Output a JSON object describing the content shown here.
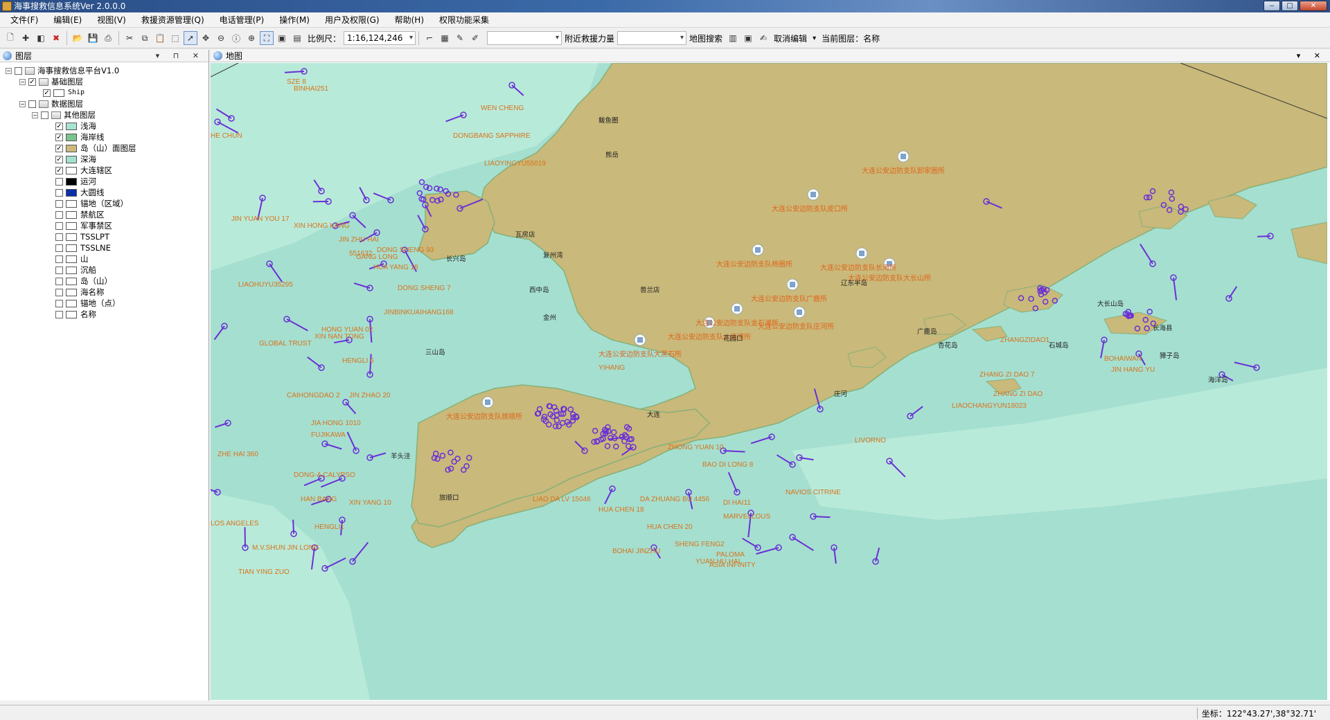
{
  "window": {
    "title": "海事搜救信息系统Ver 2.0.0.0",
    "min": "‒",
    "max": "□",
    "close": "✕"
  },
  "menubar": [
    "文件(F)",
    "编辑(E)",
    "视图(V)",
    "救援资源管理(Q)",
    "电话管理(P)",
    "操作(M)",
    "用户及权限(G)",
    "帮助(H)",
    "权限功能采集"
  ],
  "toolbar": {
    "scale_label": "比例尺：",
    "scale_value": "1:16,124,246",
    "nearby_label": "附近救援力量",
    "nearby_value": "",
    "map_search_label": "地图搜索",
    "cancel_edit_label": "取消编辑",
    "current_layer_label": "当前图层：名称"
  },
  "layer_panel": {
    "title": "图层",
    "controls": "▾ ⊓ ✕",
    "tree": {
      "root": "海事搜救信息平台V1.0",
      "base": "基础图层",
      "ship": "Ship",
      "data": "数据图层",
      "other": "其他图层",
      "layers": [
        {
          "label": "浅海",
          "checked": "✓",
          "color": "#a8e4d4"
        },
        {
          "label": "海岸线",
          "checked": "✓",
          "color": "#7cc48e"
        },
        {
          "label": "岛（山）面图层",
          "checked": "✓",
          "color": "#cdb97c"
        },
        {
          "label": "深海",
          "checked": "✓",
          "color": "#a5dfd0"
        },
        {
          "label": "大连辖区",
          "checked": "✓",
          "color": "#ffffff"
        },
        {
          "label": "运河",
          "checked": "",
          "color": "#000000"
        },
        {
          "label": "大圆线",
          "checked": "",
          "color": "#0a2fa8"
        },
        {
          "label": "锚地（区域）",
          "checked": "",
          "color": "#ffffff"
        },
        {
          "label": "禁航区",
          "checked": "",
          "color": "#ffffff"
        },
        {
          "label": "军事禁区",
          "checked": "",
          "color": "#ffffff"
        },
        {
          "label": "TSSLPT",
          "checked": "",
          "color": "#ffffff"
        },
        {
          "label": "TSSLNE",
          "checked": "",
          "color": "#ffffff"
        },
        {
          "label": "山",
          "checked": "",
          "color": "#ffffff"
        },
        {
          "label": "沉船",
          "checked": "",
          "color": "#ffffff"
        },
        {
          "label": "岛（山）",
          "checked": "",
          "color": "#ffffff"
        },
        {
          "label": "海名称",
          "checked": "",
          "color": "#ffffff"
        },
        {
          "label": "锚地（点）",
          "checked": "",
          "color": "#ffffff"
        },
        {
          "label": "名称",
          "checked": "",
          "color": "#ffffff"
        }
      ]
    }
  },
  "map_panel": {
    "title": "地图",
    "controls": "▾ ✕",
    "colors": {
      "sea": "#a5dfd0",
      "shallow": "#b8ead9",
      "land": "#c9b97a",
      "ship": "#6a2fd6",
      "ship_label": "#d9731b"
    },
    "ship_labels": [
      "SZE 8",
      "BINHAI251",
      "WEN CHENG",
      "DONGBANG SAPPHIRE",
      "LIAOYINGYU55019",
      "HE CHUN",
      "JIN YUAN YOU 17",
      "XIN HONG KANG",
      "JIN ZHU HAI",
      "GANG LONG",
      "DONG SHENG 7",
      "JINBINKUAIHANG168",
      "LIAOHUYU35295",
      "HONG YUAN 02",
      "XIN NAN TONG",
      "GLOBAL TRUST",
      "HENGLI 6",
      "CAIHONGDAO 2",
      "JIN ZHAO 20",
      "JIA HONG 1010",
      "FUJIKAWA",
      "ZHE HAI 360",
      "DONG-A CALYPSO",
      "HAN BANG",
      "XIN YANG 10",
      "LOS ANGELES",
      "HENGLI1",
      "M.V.SHUN JIN LONG",
      "TIAN YING ZUO",
      "LIAO DA LV 15046",
      "HUA CHEN 18",
      "DA ZHUANG BU 4456",
      "DI HAI11",
      "MARVELLOUS",
      "NAVIOS CITRINE",
      "BOHAI JINZHU",
      "SHENG FENG2",
      "ASIA INFINITY",
      "YUAN HU HAI",
      "PALOMA",
      "HUA CHEN 20",
      "LIVORNO",
      "BAO DI LONG 8",
      "ZHONG YUAN 10",
      "ZHANG ZI DAO 7",
      "ZHANG ZI DAO",
      "LIAOCHANGYUN18023",
      "BOHAIWAN",
      "JIN HANG YU",
      "ZHANGZIDAO1",
      "YIHANG",
      "DONG SHENG 93",
      "HUA YANG 18",
      "551632"
    ],
    "stations": [
      "大连公安边防支队卸家圈所",
      "大连公安边防支队皮口所",
      "大连公安边防支队杨圈所",
      "大连公安边防支队长海所",
      "大连公安边防支队大长山所",
      "大连公安边防支队广鹿所",
      "大连公安边防支队庄河所",
      "大连公安边防支队金石滩所",
      "大连公安边防支队大连湾所",
      "大连公安边防支队大黑石所",
      "大连公安边防支队旅顺所"
    ],
    "places": [
      "鲅鱼圈",
      "熊岳",
      "复州湾",
      "长兴岛",
      "瓦房店",
      "西中岛",
      "普兰店",
      "庄河",
      "大连",
      "旅顺口",
      "金州",
      "广鹿岛",
      "大长山岛",
      "獐子岛",
      "石城岛",
      "辽东半岛",
      "海洋岛",
      "长海县",
      "杏花岛",
      "花园口",
      "羊头洼",
      "三山岛"
    ]
  },
  "statusbar": {
    "coord": "坐标：122°43.27',38°32.71'"
  }
}
